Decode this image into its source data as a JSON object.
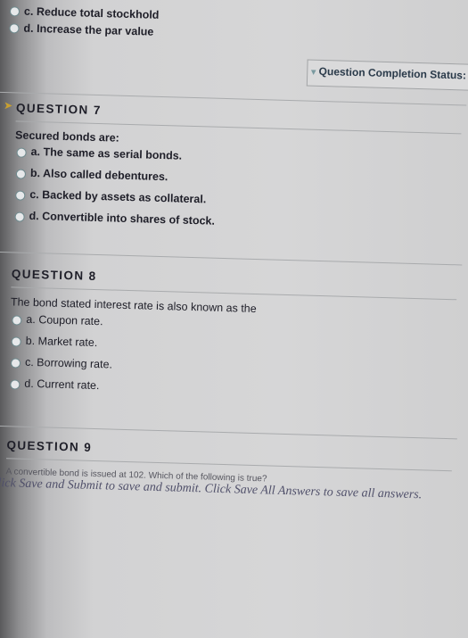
{
  "top_options": [
    {
      "letter": "c.",
      "text": "Reduce total stockhold"
    },
    {
      "letter": "d.",
      "text": "Increase the par value"
    }
  ],
  "completion_status": {
    "label": "Question Completion Status:"
  },
  "question7": {
    "title": "QUESTION 7",
    "prompt": "Secured bonds are:",
    "options": [
      {
        "letter": "a.",
        "text": "The same as serial bonds."
      },
      {
        "letter": "b.",
        "text": "Also called debentures."
      },
      {
        "letter": "c.",
        "text": "Backed by assets as collateral."
      },
      {
        "letter": "d.",
        "text": "Convertible into shares of stock."
      }
    ]
  },
  "question8": {
    "title": "QUESTION 8",
    "prompt": "The bond stated interest rate is also known as the",
    "options": [
      {
        "letter": "a.",
        "text": "Coupon rate."
      },
      {
        "letter": "b.",
        "text": "Market rate."
      },
      {
        "letter": "c.",
        "text": "Borrowing rate."
      },
      {
        "letter": "d.",
        "text": "Current rate."
      }
    ]
  },
  "question9": {
    "title": "QUESTION 9",
    "prompt": "A convertible bond is issued at 102. Which of the following is true?"
  },
  "footer": {
    "text": "Click Save and Submit to save and submit. Click Save All Answers to save all answers."
  },
  "colors": {
    "radio_border": "#6f8a8e",
    "text": "#1e1e28",
    "footer": "#50506a"
  }
}
